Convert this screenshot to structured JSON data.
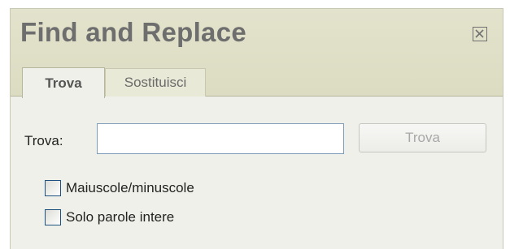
{
  "dialog": {
    "title": "Find and Replace",
    "close_icon": "close-box-icon"
  },
  "tabs": [
    {
      "label": "Trova",
      "active": true
    },
    {
      "label": "Sostituisci",
      "active": false
    }
  ],
  "find": {
    "label": "Trova:",
    "value": "",
    "button_label": "Trova",
    "button_enabled": false
  },
  "options": [
    {
      "label": "Maiuscole/minuscole",
      "checked": false
    },
    {
      "label": "Solo parole intere",
      "checked": false
    }
  ],
  "colors": {
    "header_bg": "#dcdcc2",
    "body_bg": "#f0f0ea",
    "title": "#6e6e6e"
  }
}
